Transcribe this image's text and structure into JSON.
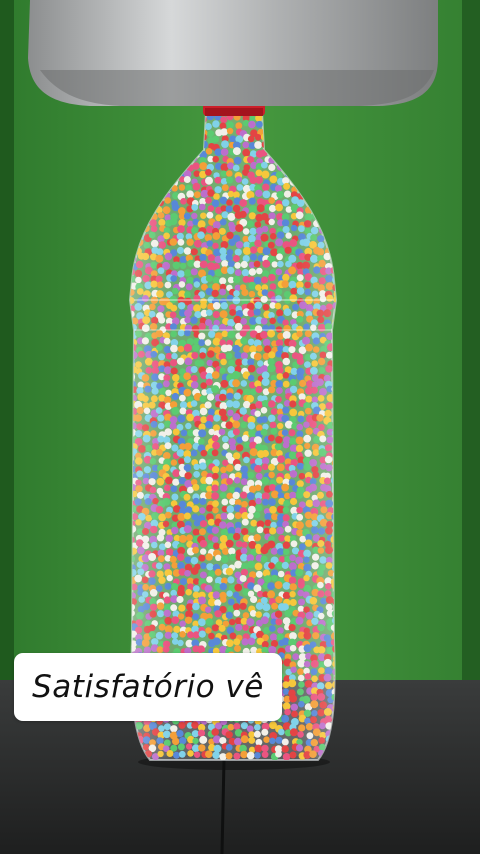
{
  "caption": {
    "text": "Satisfatório vê"
  },
  "colors": {
    "background_green": "#3c8f3a",
    "press_metal": "#a9abac",
    "table_dark": "#2d2f2f",
    "cap_red": "#cc1f2a",
    "ball_palette": [
      "#e94b7a",
      "#f39a2e",
      "#f6c431",
      "#4f82d6",
      "#53c86a",
      "#b967c9",
      "#f1efe8",
      "#e23a3a",
      "#7ad0e8"
    ]
  }
}
